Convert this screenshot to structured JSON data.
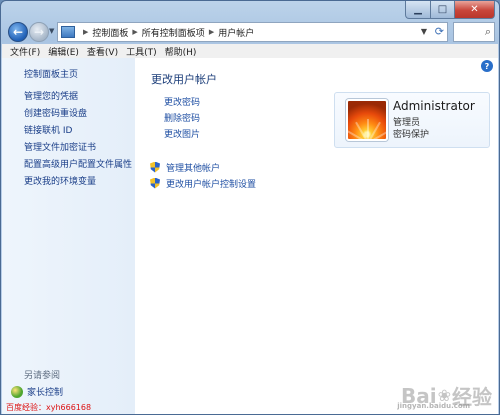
{
  "address": {
    "crumbs": [
      "控制面板",
      "所有控制面板项",
      "用户帐户"
    ]
  },
  "menu": [
    "文件(F)",
    "编辑(E)",
    "查看(V)",
    "工具(T)",
    "帮助(H)"
  ],
  "sidebar": {
    "home": "控制面板主页",
    "links": [
      "管理您的凭据",
      "创建密码重设盘",
      "链接联机 ID",
      "管理文件加密证书",
      "配置高级用户配置文件属性",
      "更改我的环境变量"
    ],
    "see_also": "另请参阅",
    "family": "家长控制"
  },
  "main": {
    "title": "更改用户帐户",
    "tasks": [
      "更改密码",
      "删除密码",
      "更改图片"
    ],
    "other_links": [
      "管理其他帐户",
      "更改用户帐户控制设置"
    ]
  },
  "user": {
    "name": "Administrator",
    "role": "管理员",
    "password_status": "密码保护"
  },
  "watermark": {
    "left": "百度经验：xyh666168",
    "logo_pre": "Bai",
    "logo_post": "经验",
    "logo_sub": "jingyan.baidu.com"
  }
}
